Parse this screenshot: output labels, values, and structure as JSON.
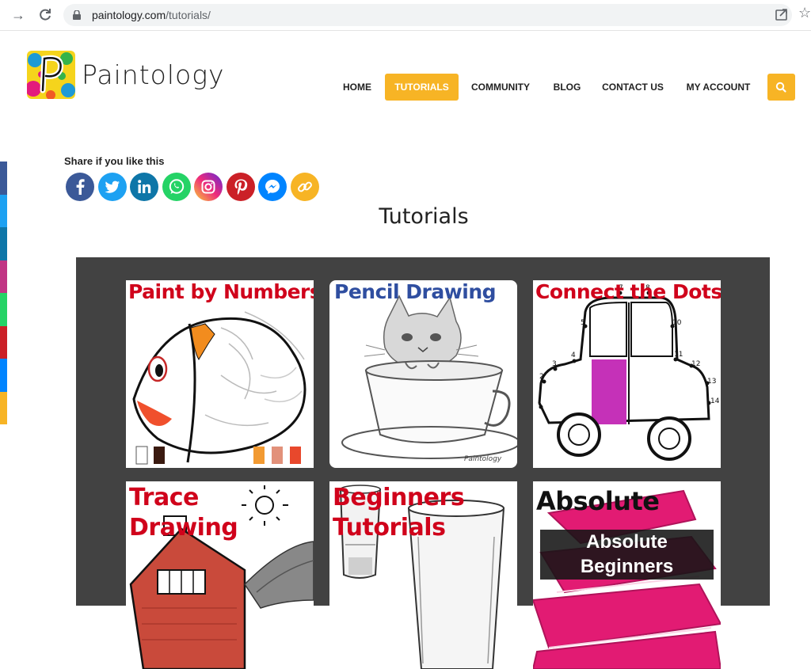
{
  "browser": {
    "url_domain": "paintology.com",
    "url_path": "/tutorials/",
    "back_icon": "arrow-right",
    "reload_icon": "reload"
  },
  "site": {
    "logo_text": "Paintology"
  },
  "nav": {
    "items": [
      {
        "label": "HOME",
        "active": false
      },
      {
        "label": "TUTORIALS",
        "active": true
      },
      {
        "label": "COMMUNITY",
        "active": false
      },
      {
        "label": "BLOG",
        "active": false
      },
      {
        "label": "CONTACT US",
        "active": false
      },
      {
        "label": "MY ACCOUNT",
        "active": false
      }
    ],
    "accent_color": "#f7b425"
  },
  "share": {
    "label": "Share if you like this",
    "buttons": [
      {
        "name": "facebook",
        "color": "#3b5998"
      },
      {
        "name": "twitter",
        "color": "#1da1f2"
      },
      {
        "name": "linkedin",
        "color": "#0e76a8"
      },
      {
        "name": "whatsapp",
        "color": "#25d366"
      },
      {
        "name": "instagram",
        "color": "#d6249f"
      },
      {
        "name": "pinterest",
        "color": "#cb2027"
      },
      {
        "name": "messenger",
        "color": "#0084ff"
      },
      {
        "name": "copy-link",
        "color": "#f7b425"
      }
    ]
  },
  "page": {
    "title": "Tutorials"
  },
  "tutorials": [
    {
      "title": "Paint by Numbers",
      "title_color": "#d0021b"
    },
    {
      "title": "Pencil Drawing",
      "title_color": "#2f4ea0"
    },
    {
      "title": "Connect the Dots",
      "title_color": "#d0021b"
    },
    {
      "title_line1": "Trace",
      "title_line2": "Drawing",
      "title_color": "#d0021b"
    },
    {
      "title_line1": "Beginners",
      "title_line2": "Tutorials",
      "title_color": "#d0021b"
    },
    {
      "title": "Absolute",
      "overlay_line1": "Absolute",
      "overlay_line2": "Beginners",
      "title_color": "#111111"
    }
  ]
}
